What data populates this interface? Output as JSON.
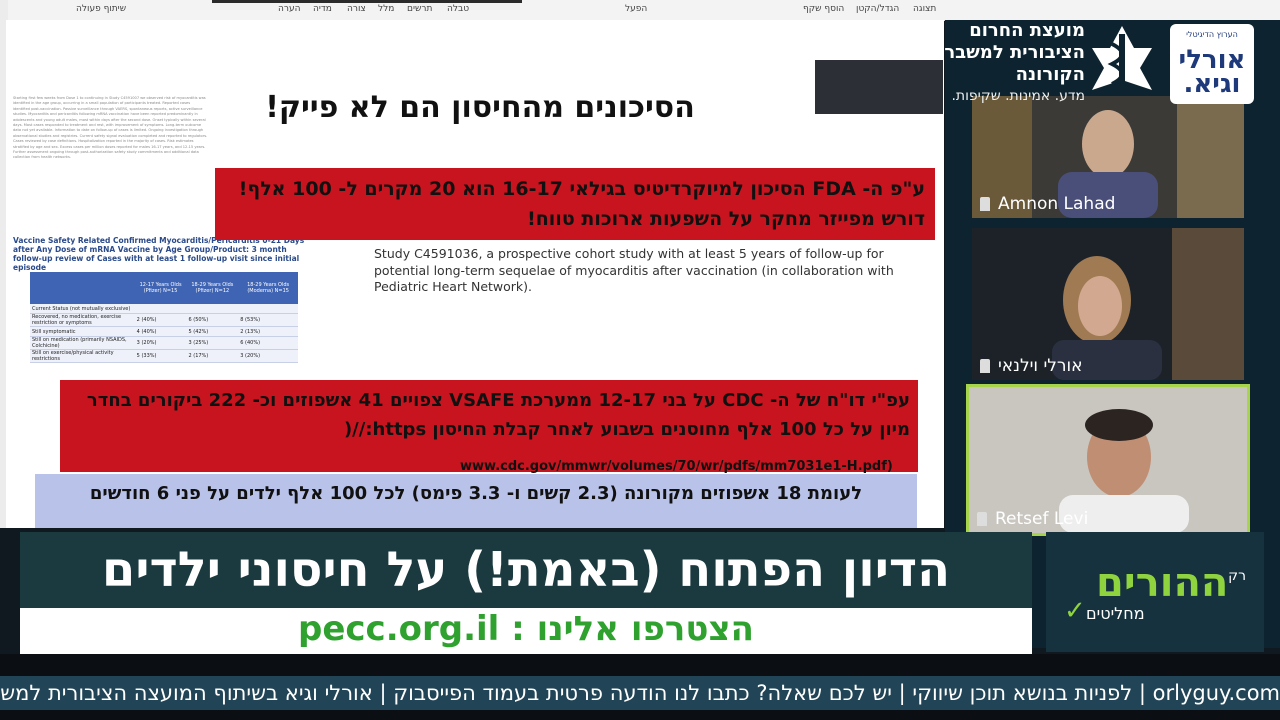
{
  "ribbon": {
    "tabs": [
      "תצוגה",
      "הגדל/הקטן",
      "הוסף שקף",
      "הפעל",
      "טבלה",
      "תרשים",
      "מלל",
      "צורה",
      "מדיה",
      "הערה",
      "שיתוף פעולה"
    ]
  },
  "slide": {
    "title": "הסיכונים מהחיסון הם לא פייק!",
    "fda_text": "ע\"פ ה- FDA הסיכון למיוקרדיטיס בגילאי 16-17 הוא 20 מקרים ל- 100 אלף! דורש מפייזר מחקר על השפעות ארוכות טווח!",
    "study_text": "Study C4591036, a prospective cohort study with at least 5 years of follow-up for potential long-term sequelae of myocarditis after vaccination (in collaboration with Pediatric Heart Network).",
    "cdc_text": "עפ\"י דו\"ח של ה- CDC על בני 12-17 ממערכת VSAFE צפויים 41 אשפוזים וכ- 222 ביקורים בחדר מיון על כל 100 אלף מחוסנים בשבוע לאחר קבלת החיסון https://(",
    "cdc_url": "www.cdc.gov/mmwr/volumes/70/wr/pdfs/mm7031e1-H.pdf)",
    "covid_text": "לעומת 18 אשפוזים מקורונה (2.3 קשים ו- 3.3 פימס) לכל 100 אלף ילדים על פני 6 חודשים",
    "paper_caption": "Vaccine Safety Related Confirmed Myocarditis/Pericarditis 0-21 Days after Any Dose of mRNA Vaccine by Age Group/Product: 3 month follow-up review of Cases with at least 1 follow-up visit since initial episode"
  },
  "mini_table": {
    "headers": [
      "",
      "12-17 Years Olds (Pfizer) N=15",
      "18-29 Years Olds (Pfizer) N=12",
      "18-29 Years Olds (Moderna) N=15"
    ],
    "rows": [
      [
        "Current Status (not mutually exclusive)",
        "",
        "",
        ""
      ],
      [
        "Recovered, no medication, exercise restriction or symptoms",
        "2 (40%)",
        "6 (50%)",
        "8 (53%)"
      ],
      [
        "Still symptomatic",
        "4 (40%)",
        "5 (42%)",
        "2 (13%)"
      ],
      [
        "Still on medication (primarily NSAIDS, Colchicine)",
        "3 (20%)",
        "3 (25%)",
        "6 (40%)"
      ],
      [
        "Still on exercise/physical activity restrictions",
        "5 (33%)",
        "2 (17%)",
        "3 (20%)"
      ]
    ]
  },
  "participants": [
    {
      "name": "Amnon Lahad"
    },
    {
      "name": "אורלי וילנאי"
    },
    {
      "name": "Retsef Levi"
    }
  ],
  "council": {
    "name": "מועצת החרום הציבורית למשבר הקורונה",
    "tagline": "מדע. אמינות. שקיפות."
  },
  "orly_logo": {
    "small": "הערוץ הדיגיטלי",
    "big": "אורלי וגיא."
  },
  "banner": {
    "title": "הדיון הפתוח (באמת!) על חיסוני ילדים",
    "site": "הצטרפו אלינו : pecc.org.il"
  },
  "parents": {
    "rak": "רק",
    "big": "ההורים",
    "small": "מחליטים"
  },
  "ticker": {
    "text": "orlyguy.com | לפניות בנושא תוכן שיווקי | יש לכם שאלה? כתבו לנו הודעה פרטית בעמוד הפייסבוק | אורלי וגיא בשיתוף המועצה הציבורית למשבר הקורונה"
  },
  "colors": {
    "slide_red": "#c8141e",
    "slide_lavender": "#b9c3ea",
    "banner_green": "#2fa12f",
    "active_speaker_border": "#a6d44a"
  }
}
